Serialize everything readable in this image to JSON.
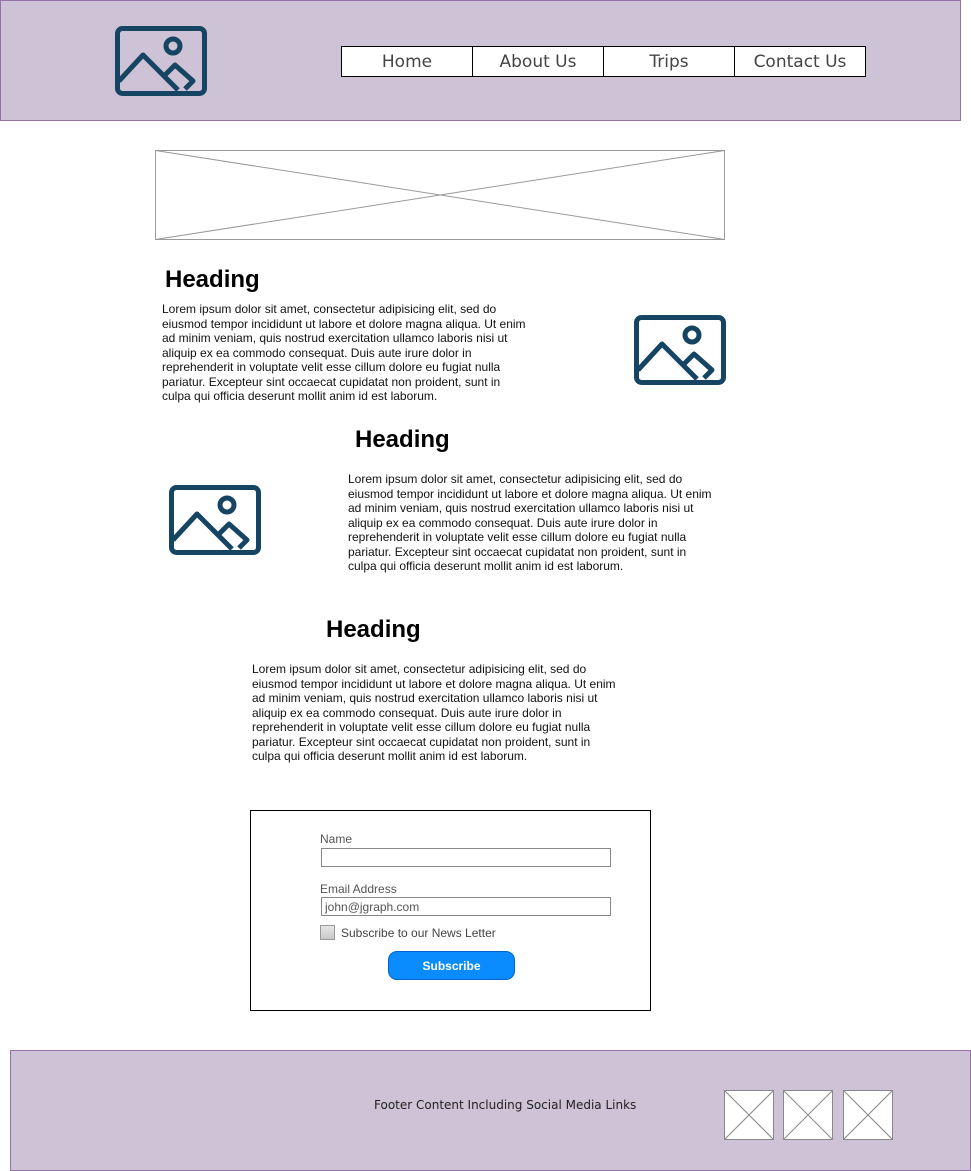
{
  "header": {
    "logo_icon": "image-placeholder-icon",
    "nav": [
      {
        "label": "Home"
      },
      {
        "label": "About Us"
      },
      {
        "label": "Trips"
      },
      {
        "label": "Contact Us"
      }
    ]
  },
  "banner": {
    "icon": "image-placeholder-x"
  },
  "sections": [
    {
      "heading": "Heading",
      "body": "Lorem ipsum dolor sit amet, consectetur adipisicing elit, sed do eiusmod tempor incididunt ut labore et dolore magna aliqua. Ut enim ad minim veniam, quis nostrud exercitation ullamco laboris nisi ut aliquip ex ea commodo consequat. Duis aute irure dolor in reprehenderit in voluptate velit esse cillum dolore eu fugiat nulla pariatur. Excepteur sint occaecat cupidatat non proident, sunt in culpa qui officia deserunt mollit anim id est laborum.",
      "image_icon": "image-placeholder-icon"
    },
    {
      "heading": "Heading",
      "body": "Lorem ipsum dolor sit amet, consectetur adipisicing elit, sed do eiusmod tempor incididunt ut labore et dolore magna aliqua. Ut enim ad minim veniam, quis nostrud exercitation ullamco laboris nisi ut aliquip ex ea commodo consequat. Duis aute irure dolor in reprehenderit in voluptate velit esse cillum dolore eu fugiat nulla pariatur. Excepteur sint occaecat cupidatat non proident, sunt in culpa qui officia deserunt mollit anim id est laborum.",
      "image_icon": "image-placeholder-icon"
    },
    {
      "heading": "Heading",
      "body": "Lorem ipsum dolor sit amet, consectetur adipisicing elit, sed do eiusmod tempor incididunt ut labore et dolore magna aliqua. Ut enim ad minim veniam, quis nostrud exercitation ullamco laboris nisi ut aliquip ex ea commodo consequat. Duis aute irure dolor in reprehenderit in voluptate velit esse cillum dolore eu fugiat nulla pariatur. Excepteur sint occaecat cupidatat non proident, sunt in culpa qui officia deserunt mollit anim id est laborum."
    }
  ],
  "form": {
    "name_label": "Name",
    "name_value": "",
    "email_label": "Email Address",
    "email_value": "john@jgraph.com",
    "checkbox_label": "Subscribe to our News Letter",
    "checkbox_checked": false,
    "submit_label": "Subscribe"
  },
  "footer": {
    "text": "Footer Content Including Social Media Links",
    "social_icons": [
      "image-placeholder-x",
      "image-placeholder-x",
      "image-placeholder-x"
    ]
  },
  "colors": {
    "header_bg": "#cdc2d6",
    "header_border": "#9673a6",
    "icon_stroke": "#164563",
    "button_bg": "#0a8cff"
  }
}
